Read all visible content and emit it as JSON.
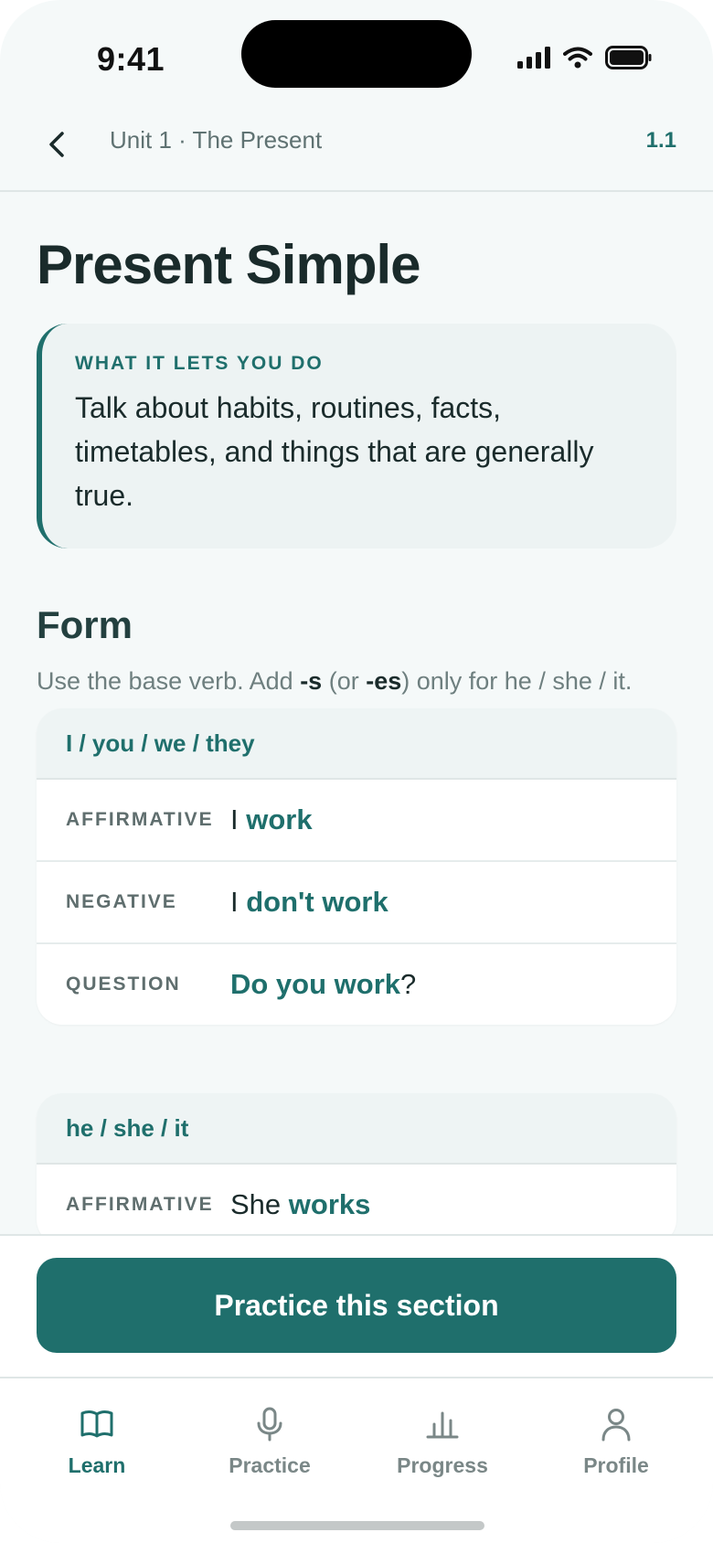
{
  "status_bar": {
    "time": "9:41"
  },
  "header": {
    "breadcrumb": "Unit 1 · The Present",
    "section_number": "1.1"
  },
  "lesson": {
    "title": "Present Simple",
    "callout": {
      "label": "WHAT IT LETS YOU DO",
      "text": "Talk about habits, routines, facts, timetables, and things that are generally true."
    },
    "form": {
      "heading": "Form",
      "desc_start": "Use the base verb. Add ",
      "desc_s": "-s",
      "desc_mid": " (or ",
      "desc_es": "-es",
      "desc_end": ") only for he / she / it."
    },
    "tables": [
      {
        "header": "I / you / we / they",
        "rows": [
          {
            "label": "AFFIRMATIVE",
            "pre": "I ",
            "verb": "work",
            "post": ""
          },
          {
            "label": "NEGATIVE",
            "pre": "I ",
            "verb": "don't work",
            "post": ""
          },
          {
            "label": "QUESTION",
            "pre": "",
            "verb": "Do you work",
            "post": "?"
          }
        ]
      },
      {
        "header": "he / she / it",
        "rows": [
          {
            "label": "AFFIRMATIVE",
            "pre": "She ",
            "verb": "works",
            "post": ""
          }
        ]
      }
    ]
  },
  "cta": {
    "label": "Practice this section"
  },
  "tabs": [
    {
      "label": "Learn",
      "icon": "book-icon",
      "active": true
    },
    {
      "label": "Practice",
      "icon": "microphone-icon",
      "active": false
    },
    {
      "label": "Progress",
      "icon": "bar-chart-icon",
      "active": false
    },
    {
      "label": "Profile",
      "icon": "person-icon",
      "active": false
    }
  ],
  "colors": {
    "accent": "#1f6f6c",
    "background": "#f5f9f9",
    "text": "#1a2b2b"
  }
}
